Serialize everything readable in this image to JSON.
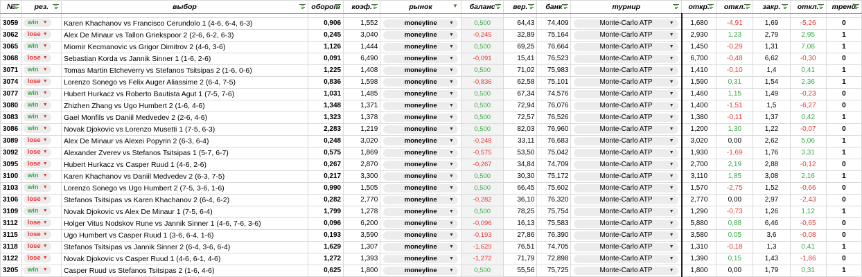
{
  "headers": {
    "id": "№",
    "res": "рез.",
    "match": "выбор",
    "turnover": "оборот",
    "coef": "коэф.",
    "market": "рынок",
    "balance": "баланс",
    "prob": "вер.",
    "bank": "банк",
    "tournament": "турнир",
    "open": "откр.",
    "dev1": "откл.",
    "close": "закр.",
    "dev2": "откл.",
    "trend": "тренд"
  },
  "colors": {
    "win": "#3aa84a",
    "lose": "#e53935",
    "filter_icon": "#4a7c3c"
  },
  "rows": [
    {
      "id": "3059",
      "res": "win",
      "match": "Karen Khachanov vs Francisco Cerundolo 1 (4-6, 6-4, 6-3)",
      "turnover": "0,906",
      "coef": "1,552",
      "market": "moneyline",
      "balance": "0,500",
      "prob": "64,43",
      "bank": "74,409",
      "tournament": "Monte-Carlo ATP",
      "open": "1,680",
      "dev1": "-4,91",
      "close": "1,69",
      "dev2": "-5,26",
      "trend": "0"
    },
    {
      "id": "3062",
      "res": "lose",
      "match": "Alex De Minaur vs Tallon Griekspoor 2 (2-6, 6-2, 6-3)",
      "turnover": "0,245",
      "coef": "3,040",
      "market": "moneyline",
      "balance": "-0,245",
      "prob": "32,89",
      "bank": "75,164",
      "tournament": "Monte-Carlo ATP",
      "open": "2,930",
      "dev1": "1,23",
      "close": "2,79",
      "dev2": "2,95",
      "trend": "1"
    },
    {
      "id": "3065",
      "res": "win",
      "match": "Miomir Kecmanovic vs Grigor Dimitrov 2 (4-6, 3-6)",
      "turnover": "1,126",
      "coef": "1,444",
      "market": "moneyline",
      "balance": "0,500",
      "prob": "69,25",
      "bank": "76,664",
      "tournament": "Monte-Carlo ATP",
      "open": "1,450",
      "dev1": "-0,29",
      "close": "1,31",
      "dev2": "7,08",
      "trend": "1"
    },
    {
      "id": "3068",
      "res": "lose",
      "match": "Sebastian Korda vs Jannik Sinner 1 (1-6, 2-6)",
      "turnover": "0,091",
      "coef": "6,490",
      "market": "moneyline",
      "balance": "-0,091",
      "prob": "15,41",
      "bank": "76,523",
      "tournament": "Monte-Carlo ATP",
      "open": "6,700",
      "dev1": "-0,48",
      "close": "6,62",
      "dev2": "-0,30",
      "trend": "0"
    },
    {
      "id": "3071",
      "res": "win",
      "match": "Tomas Martin Etcheverry vs Stefanos Tsitsipas 2 (1-6, 0-6)",
      "turnover": "1,225",
      "coef": "1,408",
      "market": "moneyline",
      "balance": "0,500",
      "prob": "71,02",
      "bank": "75,983",
      "tournament": "Monte-Carlo ATP",
      "open": "1,410",
      "dev1": "-0,10",
      "close": "1,4",
      "dev2": "0,41",
      "trend": "1"
    },
    {
      "id": "3074",
      "res": "lose",
      "match": "Lorenzo Sonego vs Felix Auger Aliassime 2 (6-4, 7-5)",
      "turnover": "0,836",
      "coef": "1,598",
      "market": "moneyline",
      "balance": "-0,836",
      "prob": "62,58",
      "bank": "75,101",
      "tournament": "Monte-Carlo ATP",
      "open": "1,590",
      "dev1": "0,31",
      "close": "1,54",
      "dev2": "2,36",
      "trend": "1"
    },
    {
      "id": "3077",
      "res": "win",
      "match": "Hubert Hurkacz vs Roberto Bautista Agut 1 (7-5, 7-6)",
      "turnover": "1,031",
      "coef": "1,485",
      "market": "moneyline",
      "balance": "0,500",
      "prob": "67,34",
      "bank": "74,576",
      "tournament": "Monte-Carlo ATP",
      "open": "1,460",
      "dev1": "1,15",
      "close": "1,49",
      "dev2": "-0,23",
      "trend": "0"
    },
    {
      "id": "3080",
      "res": "win",
      "match": "Zhizhen Zhang vs Ugo Humbert 2 (1-6, 4-6)",
      "turnover": "1,348",
      "coef": "1,371",
      "market": "moneyline",
      "balance": "0,500",
      "prob": "72,94",
      "bank": "76,076",
      "tournament": "Monte-Carlo ATP",
      "open": "1,400",
      "dev1": "-1,51",
      "close": "1,5",
      "dev2": "-6,27",
      "trend": "0"
    },
    {
      "id": "3083",
      "res": "win",
      "match": "Gael Monfils vs Daniil Medvedev 2 (2-6, 4-6)",
      "turnover": "1,323",
      "coef": "1,378",
      "market": "moneyline",
      "balance": "0,500",
      "prob": "72,57",
      "bank": "76,526",
      "tournament": "Monte-Carlo ATP",
      "open": "1,380",
      "dev1": "-0,11",
      "close": "1,37",
      "dev2": "0,42",
      "trend": "1"
    },
    {
      "id": "3086",
      "res": "win",
      "match": "Novak Djokovic vs Lorenzo Musetti 1 (7-5, 6-3)",
      "turnover": "2,283",
      "coef": "1,219",
      "market": "moneyline",
      "balance": "0,500",
      "prob": "82,03",
      "bank": "76,960",
      "tournament": "Monte-Carlo ATP",
      "open": "1,200",
      "dev1": "1,30",
      "close": "1,22",
      "dev2": "-0,07",
      "trend": "0"
    },
    {
      "id": "3089",
      "res": "lose",
      "match": "Alex De Minaur vs Alexei Popyrin 2 (6-3, 6-4)",
      "turnover": "0,248",
      "coef": "3,020",
      "market": "moneyline",
      "balance": "-0,248",
      "prob": "33,11",
      "bank": "76,683",
      "tournament": "Monte-Carlo ATP",
      "open": "3,020",
      "dev1": "0,00",
      "close": "2,62",
      "dev2": "5,06",
      "trend": "1"
    },
    {
      "id": "3092",
      "res": "lose",
      "match": "Alexander Zverev vs Stefanos Tsitsipas 1 (5-7, 6-7)",
      "turnover": "0,575",
      "coef": "1,869",
      "market": "moneyline",
      "balance": "-0,575",
      "prob": "53,50",
      "bank": "75,042",
      "tournament": "Monte-Carlo ATP",
      "open": "1,930",
      "dev1": "-1,69",
      "close": "1,76",
      "dev2": "3,31",
      "trend": "1"
    },
    {
      "id": "3095",
      "res": "lose",
      "match": "Hubert Hurkacz vs Casper Ruud 1 (4-6, 2-6)",
      "turnover": "0,267",
      "coef": "2,870",
      "market": "moneyline",
      "balance": "-0,267",
      "prob": "34,84",
      "bank": "74,709",
      "tournament": "Monte-Carlo ATP",
      "open": "2,700",
      "dev1": "2,19",
      "close": "2,88",
      "dev2": "-0,12",
      "trend": "0"
    },
    {
      "id": "3100",
      "res": "win",
      "match": "Karen Khachanov vs Daniil Medvedev 2 (6-3, 7-5)",
      "turnover": "0,217",
      "coef": "3,300",
      "market": "moneyline",
      "balance": "0,500",
      "prob": "30,30",
      "bank": "75,172",
      "tournament": "Monte-Carlo ATP",
      "open": "3,110",
      "dev1": "1,85",
      "close": "3,08",
      "dev2": "2,16",
      "trend": "1"
    },
    {
      "id": "3103",
      "res": "win",
      "match": "Lorenzo Sonego vs Ugo Humbert 2 (7-5, 3-6, 1-6)",
      "turnover": "0,990",
      "coef": "1,505",
      "market": "moneyline",
      "balance": "0,500",
      "prob": "66,45",
      "bank": "75,602",
      "tournament": "Monte-Carlo ATP",
      "open": "1,570",
      "dev1": "-2,75",
      "close": "1,52",
      "dev2": "-0,66",
      "trend": "0"
    },
    {
      "id": "3106",
      "res": "lose",
      "match": "Stefanos Tsitsipas vs Karen Khachanov 2 (6-4, 6-2)",
      "turnover": "0,282",
      "coef": "2,770",
      "market": "moneyline",
      "balance": "-0,282",
      "prob": "36,10",
      "bank": "76,320",
      "tournament": "Monte-Carlo ATP",
      "open": "2,770",
      "dev1": "0,00",
      "close": "2,97",
      "dev2": "-2,43",
      "trend": "0"
    },
    {
      "id": "3109",
      "res": "win",
      "match": "Novak Djokovic vs Alex De Minaur 1 (7-5, 6-4)",
      "turnover": "1,799",
      "coef": "1,278",
      "market": "moneyline",
      "balance": "0,500",
      "prob": "78,25",
      "bank": "75,754",
      "tournament": "Monte-Carlo ATP",
      "open": "1,290",
      "dev1": "-0,73",
      "close": "1,26",
      "dev2": "1,12",
      "trend": "1"
    },
    {
      "id": "3112",
      "res": "lose",
      "match": "Holger Vitus Nodskov Rune vs Jannik Sinner 1 (4-6, 7-6, 3-6)",
      "turnover": "0,096",
      "coef": "6,200",
      "market": "moneyline",
      "balance": "-0,096",
      "prob": "16,13",
      "bank": "75,583",
      "tournament": "Monte-Carlo ATP",
      "open": "5,880",
      "dev1": "0,88",
      "close": "6,46",
      "dev2": "-0,65",
      "trend": "0"
    },
    {
      "id": "3115",
      "res": "lose",
      "match": "Ugo Humbert vs Casper Ruud 1 (3-6, 6-4, 1-6)",
      "turnover": "0,193",
      "coef": "3,590",
      "market": "moneyline",
      "balance": "-0,193",
      "prob": "27,86",
      "bank": "76,390",
      "tournament": "Monte-Carlo ATP",
      "open": "3,580",
      "dev1": "0,05",
      "close": "3,6",
      "dev2": "-0,08",
      "trend": "0"
    },
    {
      "id": "3118",
      "res": "lose",
      "match": "Stefanos Tsitsipas vs Jannik Sinner 2 (6-4, 3-6, 6-4)",
      "turnover": "1,629",
      "coef": "1,307",
      "market": "moneyline",
      "balance": "-1,629",
      "prob": "76,51",
      "bank": "74,705",
      "tournament": "Monte-Carlo ATP",
      "open": "1,310",
      "dev1": "-0,18",
      "close": "1,3",
      "dev2": "0,41",
      "trend": "1"
    },
    {
      "id": "3122",
      "res": "lose",
      "match": "Novak Djokovic vs Casper Ruud 1 (4-6, 6-1, 4-6)",
      "turnover": "1,272",
      "coef": "1,393",
      "market": "moneyline",
      "balance": "-1,272",
      "prob": "71,79",
      "bank": "72,898",
      "tournament": "Monte-Carlo ATP",
      "open": "1,390",
      "dev1": "0,15",
      "close": "1,43",
      "dev2": "-1,86",
      "trend": "0"
    },
    {
      "id": "3205",
      "res": "win",
      "match": "Casper Ruud vs Stefanos Tsitsipas 2 (1-6, 4-6)",
      "turnover": "0,625",
      "coef": "1,800",
      "market": "moneyline",
      "balance": "0,500",
      "prob": "55,56",
      "bank": "75,725",
      "tournament": "Monte-Carlo ATP",
      "open": "1,800",
      "dev1": "0,00",
      "close": "1,79",
      "dev2": "0,31",
      "trend": "1"
    }
  ]
}
